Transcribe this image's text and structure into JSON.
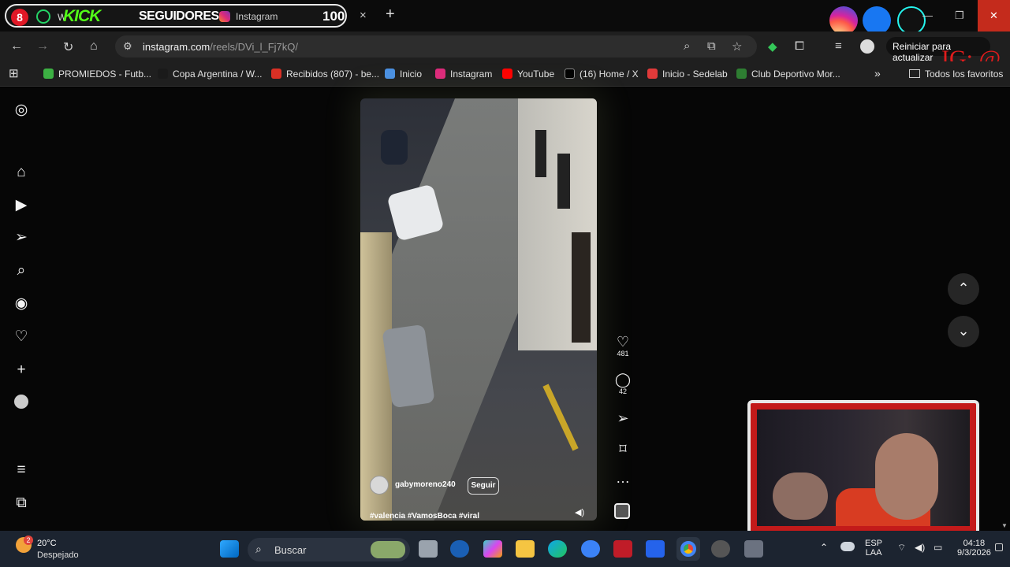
{
  "tab": {
    "badge": "8",
    "whatsapp_label": "W",
    "kick_overlay": "KICK",
    "followers_overlay": "SEGUIDORES",
    "title": "Instagram",
    "followers_count": "100",
    "close": "×",
    "new_tab": "+"
  },
  "window": {
    "minimize": "—",
    "restore": "❐",
    "close": "✕"
  },
  "address": {
    "url_host": "instagram.com",
    "url_path": "/reels/DVi_l_Fj7kQ/"
  },
  "toolbar": {
    "update_label": "Reiniciar para actualizar",
    "ig_watermark": "IG: @"
  },
  "bookmarks": [
    {
      "label": "PROMIEDOS - Futb...",
      "color": "#3cb043"
    },
    {
      "label": "Copa Argentina / W...",
      "color": "#1a1a1a"
    },
    {
      "label": "Recibidos (807) - be...",
      "color": "#d93025"
    },
    {
      "label": "Inicio",
      "color": "#4a90e2"
    },
    {
      "label": "Instagram",
      "color": "#dd2a7b"
    },
    {
      "label": "YouTube",
      "color": "#ff0000"
    },
    {
      "label": "(16) Home / X",
      "color": "#000000"
    },
    {
      "label": "Inicio - Sedelab",
      "color": "#e03a3a"
    },
    {
      "label": "Club Deportivo Mor...",
      "color": "#2e7d32"
    }
  ],
  "bookmarks_more": "»",
  "all_bookmarks": "Todos los favoritos",
  "reel": {
    "username": "gabymoreno240",
    "follow_label": "Seguir",
    "hashtags": "#valencia #VamosBoca #viral",
    "likes": "481",
    "comments": "42"
  },
  "taskbar": {
    "temperature": "20°C",
    "condition": "Despejado",
    "weather_badge": "2",
    "search_placeholder": "Buscar",
    "lang_top": "ESP",
    "lang_bottom": "LAA",
    "time": "04:18",
    "date": "9/3/2026"
  }
}
